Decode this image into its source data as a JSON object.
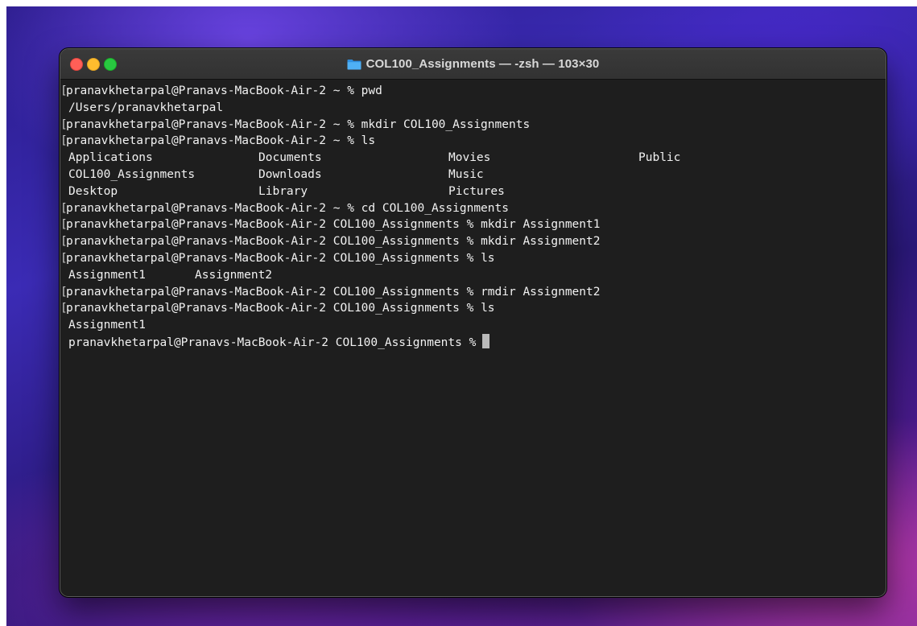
{
  "window": {
    "title": "COL100_Assignments — -zsh — 103×30",
    "icon": "folder-icon",
    "accent_folder_color": "#3aa0f0"
  },
  "terminal": {
    "lines": [
      {
        "type": "cmd",
        "prompt": "pranavkhetarpal@Pranavs-MacBook-Air-2 ~ % ",
        "command": "pwd"
      },
      {
        "type": "out",
        "text": "/Users/pranavkhetarpal"
      },
      {
        "type": "cmd",
        "prompt": "pranavkhetarpal@Pranavs-MacBook-Air-2 ~ % ",
        "command": "mkdir COL100_Assignments"
      },
      {
        "type": "cmd",
        "prompt": "pranavkhetarpal@Pranavs-MacBook-Air-2 ~ % ",
        "command": "ls"
      }
    ],
    "ls_home": [
      [
        "Applications",
        "Documents",
        "Movies",
        "Public"
      ],
      [
        "COL100_Assignments",
        "Downloads",
        "Music",
        ""
      ],
      [
        "Desktop",
        "Library",
        "Pictures",
        ""
      ]
    ],
    "lines2": [
      {
        "type": "cmd",
        "prompt": "pranavkhetarpal@Pranavs-MacBook-Air-2 ~ % ",
        "command": "cd COL100_Assignments"
      },
      {
        "type": "cmd",
        "prompt": "pranavkhetarpal@Pranavs-MacBook-Air-2 COL100_Assignments % ",
        "command": "mkdir Assignment1"
      },
      {
        "type": "cmd",
        "prompt": "pranavkhetarpal@Pranavs-MacBook-Air-2 COL100_Assignments % ",
        "command": "mkdir Assignment2"
      },
      {
        "type": "cmd",
        "prompt": "pranavkhetarpal@Pranavs-MacBook-Air-2 COL100_Assignments % ",
        "command": "ls"
      }
    ],
    "ls_assign": [
      "Assignment1",
      "Assignment2"
    ],
    "lines3": [
      {
        "type": "cmd",
        "prompt": "pranavkhetarpal@Pranavs-MacBook-Air-2 COL100_Assignments % ",
        "command": "rmdir Assignment2"
      },
      {
        "type": "cmd",
        "prompt": "pranavkhetarpal@Pranavs-MacBook-Air-2 COL100_Assignments % ",
        "command": "ls"
      },
      {
        "type": "out",
        "text": "Assignment1"
      }
    ],
    "current_prompt": "pranavkhetarpal@Pranavs-MacBook-Air-2 COL100_Assignments %"
  }
}
